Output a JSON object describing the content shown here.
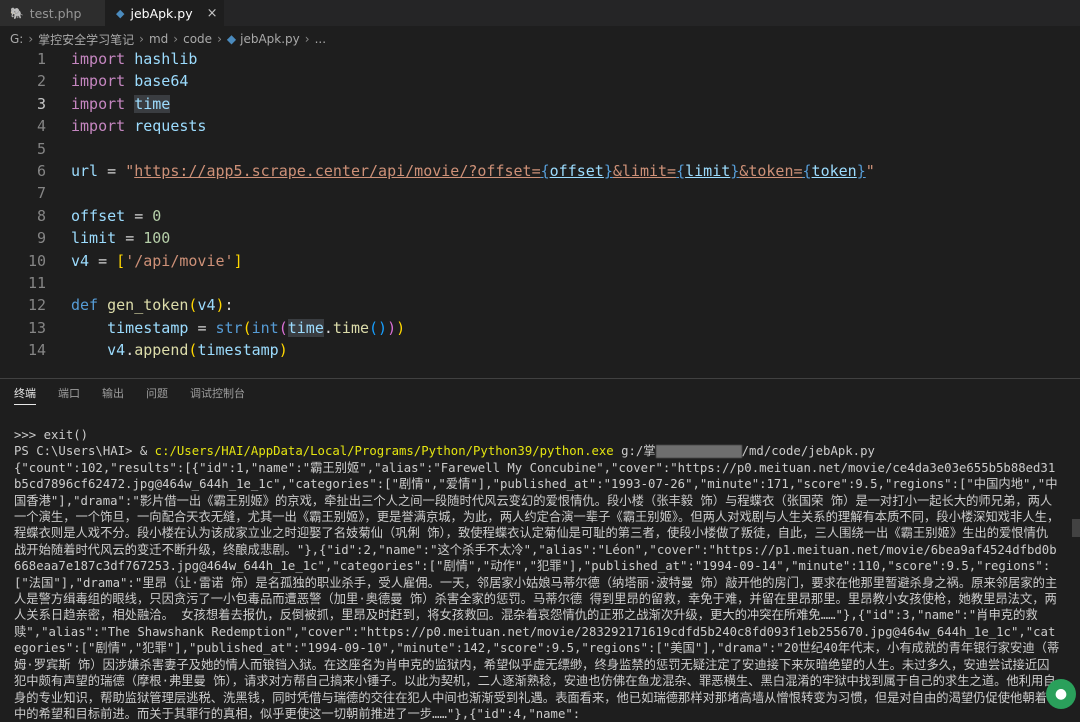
{
  "tabs": [
    {
      "label": "test.php",
      "icon": "php-icon"
    },
    {
      "label": "jebApk.py",
      "icon": "python-icon",
      "close": "×"
    }
  ],
  "breadcrumb": {
    "parts": [
      "G:",
      "掌控安全学习笔记",
      "md",
      "code",
      "jebApk.py",
      "..."
    ]
  },
  "editor": {
    "line_numbers": [
      "1",
      "2",
      "3",
      "4",
      "5",
      "6",
      "7",
      "8",
      "9",
      "10",
      "11",
      "12",
      "13",
      "14"
    ]
  },
  "panel": {
    "tabs": [
      "终端",
      "端口",
      "输出",
      "问题",
      "调试控制台"
    ]
  },
  "terminal": {
    "line1": ">>> exit()",
    "prompt": "PS C:\\Users\\HAI> & ",
    "python_path": "c:/Users/HAI/AppData/Local/Programs/Python/Python39/python.exe",
    "script_prefix": "g:/掌",
    "script_suffix": "/md/code/jebApk.py",
    "output": "{\"count\":102,\"results\":[{\"id\":1,\"name\":\"霸王别姬\",\"alias\":\"Farewell My Concubine\",\"cover\":\"https://p0.meituan.net/movie/ce4da3e03e655b5b88ed31b5cd7896cf62472.jpg@464w_644h_1e_1c\",\"categories\":[\"剧情\",\"爱情\"],\"published_at\":\"1993-07-26\",\"minute\":171,\"score\":9.5,\"regions\":[\"中国内地\",\"中国香港\"],\"drama\":\"影片借一出《霸王别姬》的京戏，牵扯出三个人之间一段随时代风云变幻的爱恨情仇。段小楼（张丰毅 饰）与程蝶衣（张国荣 饰）是一对打小一起长大的师兄弟，两人一个演生，一个饰旦，一向配合天衣无缝，尤其一出《霸王别姬》，更是誉满京城，为此，两人约定合演一辈子《霸王别姬》。但两人对戏剧与人生关系的理解有本质不同，段小楼深知戏非人生，程蝶衣则是人戏不分。段小楼在认为该成家立业之时迎娶了名妓菊仙（巩俐 饰），致使程蝶衣认定菊仙是可耻的第三者，使段小楼做了叛徒，自此，三人围绕一出《霸王别姬》生出的爱恨情仇战开始随着时代风云的变迁不断升级，终酿成悲剧。\"},{\"id\":2,\"name\":\"这个杀手不太冷\",\"alias\":\"Léon\",\"cover\":\"https://p1.meituan.net/movie/6bea9af4524dfbd0b668eaa7e187c3df767253.jpg@464w_644h_1e_1c\",\"categories\":[\"剧情\",\"动作\",\"犯罪\"],\"published_at\":\"1994-09-14\",\"minute\":110,\"score\":9.5,\"regions\":[\"法国\"],\"drama\":\"里昂（让·雷诺 饰）是名孤独的职业杀手，受人雇佣。一天，邻居家小姑娘马蒂尔德（纳塔丽·波特曼 饰）敲开他的房门，要求在他那里暂避杀身之祸。原来邻居家的主人是警方缉毒组的眼线，只因贪污了一小包毒品而遭恶警（加里·奥德曼 饰）杀害全家的惩罚。马蒂尔德 得到里昂的留救，幸免于难，并留在里昂那里。里昂教小女孩使枪，她教里昂法文，两人关系日趋亲密，相处融洽。 女孩想着去报仇，反倒被抓，里昂及时赶到，将女孩救回。混杂着哀怨情仇的正邪之战渐次升级，更大的冲突在所难免……\"},{\"id\":3,\"name\":\"肖申克的救赎\",\"alias\":\"The Shawshank Redemption\",\"cover\":\"https://p0.meituan.net/movie/283292171619cdfd5b240c8fd093f1eb255670.jpg@464w_644h_1e_1c\",\"categories\":[\"剧情\",\"犯罪\"],\"published_at\":\"1994-09-10\",\"minute\":142,\"score\":9.5,\"regions\":[\"美国\"],\"drama\":\"20世纪40年代末，小有成就的青年银行家安迪（蒂姆·罗宾斯 饰）因涉嫌杀害妻子及她的情人而锒铛入狱。在这座名为肖申克的监狱内，希望似乎虚无缥缈，终身监禁的惩罚无疑注定了安迪接下来灰暗绝望的人生。未过多久，安迪尝试接近囚犯中颇有声望的瑞德（摩根·弗里曼 饰），请求对方帮自己搞来小锤子。以此为契机，二人逐渐熟稔，安迪也仿佛在鱼龙混杂、罪恶横生、黑白混淆的牢狱中找到属于自己的求生之道。他利用自身的专业知识，帮助监狱管理层逃税、洗黑钱，同时凭借与瑞德的交往在犯人中间也渐渐受到礼遇。表面看来，他已如瑞德那样对那堵高墙从憎恨转变为习惯，但是对自由的渴望仍促使他朝着心中的希望和目标前进。而关于其罪行的真相，似乎更使这一切朝前推进了一步……\"},{\"id\":4,\"name\":"
  }
}
